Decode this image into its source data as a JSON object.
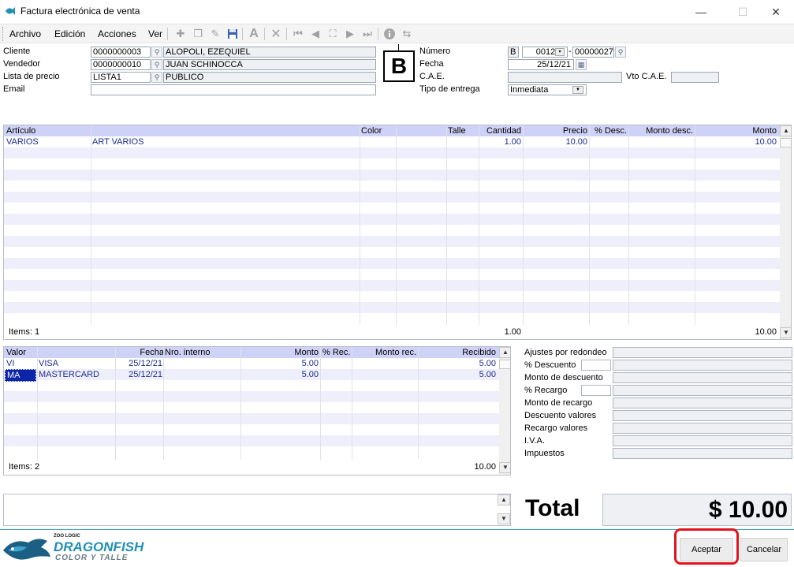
{
  "window": {
    "title": "Factura electrónica de venta",
    "minimize": "—",
    "maximize": "☐",
    "close": "✕"
  },
  "menu": {
    "archivo": "Archivo",
    "edicion": "Edición",
    "acciones": "Acciones",
    "ver": "Ver"
  },
  "header": {
    "cliente_label": "Cliente",
    "cliente_code": "0000000003",
    "cliente_name": "ALOPOLI, EZEQUIEL",
    "vendedor_label": "Vendedor",
    "vendedor_code": "0000000010",
    "vendedor_name": "JUAN SCHINOCCA",
    "lista_label": "Lista de precio",
    "lista_code": "LISTA1",
    "lista_name": "PUBLICO",
    "email_label": "Email",
    "email_value": "",
    "tipo_letra": "B",
    "numero_label": "Número",
    "numero_letra": "B",
    "numero_pv": "0012",
    "numero_nro": "00000027",
    "fecha_label": "Fecha",
    "fecha_value": "25/12/21",
    "cae_label": "C.A.E.",
    "cae_value": "",
    "vto_cae_label": "Vto C.A.E.",
    "vto_cae_value": "",
    "entrega_label": "Tipo de entrega",
    "entrega_value": "Inmediata"
  },
  "items_grid": {
    "columns": {
      "articulo": "Artículo",
      "color": "Color",
      "talle": "Talle",
      "cantidad": "Cantidad",
      "precio": "Precio",
      "desc": "% Desc.",
      "monto_desc": "Monto desc.",
      "monto": "Monto"
    },
    "rows": [
      {
        "codigo": "VARIOS",
        "descripcion": "ART VARIOS",
        "cantidad": "1.00",
        "precio": "10.00",
        "monto": "10.00"
      }
    ],
    "footer": {
      "items": "Items: 1",
      "cantidad": "1.00",
      "monto": "10.00"
    }
  },
  "values_grid": {
    "columns": {
      "valor": "Valor",
      "fecha": "Fecha",
      "nro": "Nro. interno",
      "monto": "Monto",
      "rec": "% Rec.",
      "monto_rec": "Monto rec.",
      "recibido": "Recibido"
    },
    "rows": [
      {
        "codigo": "VI",
        "nombre": "VISA",
        "fecha": "25/12/21",
        "monto": "5.00",
        "recibido": "5.00"
      },
      {
        "codigo": "MA",
        "nombre": "MASTERCARD",
        "fecha": "25/12/21",
        "monto": "5.00",
        "recibido": "5.00"
      }
    ],
    "footer": {
      "items": "Items: 2",
      "recibido": "10.00"
    }
  },
  "totals": {
    "ajustes": "Ajustes por redondeo",
    "pct_descuento": "% Descuento",
    "monto_descuento": "Monto de descuento",
    "pct_recargo": "% Recargo",
    "monto_recargo": "Monto de recargo",
    "descuento_valores": "Descuento valores",
    "recargo_valores": "Recargo valores",
    "iva": "I.V.A.",
    "impuestos": "Impuestos",
    "total_label": "Total",
    "total_value": "$ 10.00"
  },
  "logo": {
    "zoo": "ZOO LOGIC",
    "brand": "DRAGONFISH",
    "tagline": "COLOR Y TALLE"
  },
  "buttons": {
    "aceptar": "Aceptar",
    "cancelar": "Cancelar"
  },
  "colors": {
    "grid_header": "#cfd2f7",
    "grid_text": "#1c2c8c",
    "highlight": "#e0141e",
    "selection": "#0b24a8"
  }
}
